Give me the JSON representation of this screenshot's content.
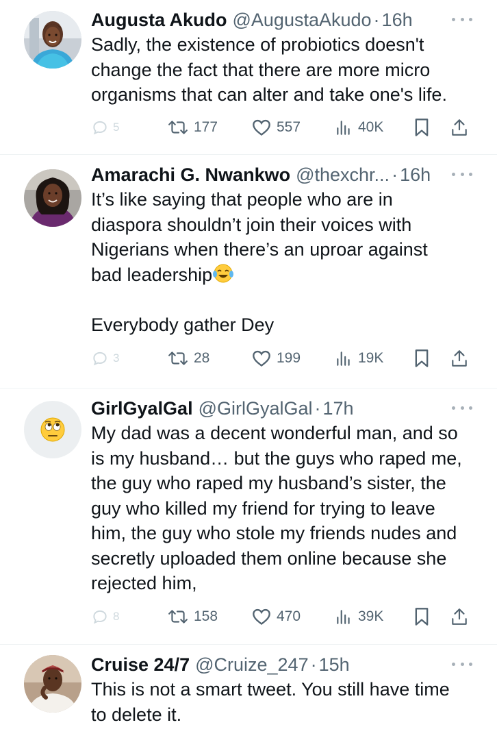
{
  "tweets": [
    {
      "display_name": "Augusta Akudo",
      "handle": "@AugustaAkudo",
      "separator": "·",
      "time": "16h",
      "text": "Sadly, the existence of probiotics doesn't\nchange the fact that there are more micro\norganisms that can alter and take one's life.",
      "replies": "5",
      "retweets": "177",
      "likes": "557",
      "views": "40K"
    },
    {
      "display_name": "Amarachi G. Nwankwo",
      "handle": "@thexchr...",
      "separator": "·",
      "time": "16h",
      "text_before_emoji": "It’s like saying that people who are in\ndiaspora shouldn’t join their voices with\nNigerians when there’s an uproar against\nbad leadership",
      "emoji": "face-with-tears-of-joy",
      "text_after_emoji": "\n\nEverybody gather Dey",
      "replies": "3",
      "retweets": "28",
      "likes": "199",
      "views": "19K"
    },
    {
      "display_name": "GirlGyalGal",
      "handle": "@GirlGyalGal",
      "separator": "·",
      "time": "17h",
      "text": "My dad was a decent wonderful man, and so\nis my husband… but the guys who raped me,\nthe guy who raped my husband’s sister, the\nguy who killed my friend for trying to leave\nhim, the guy who stole my friends nudes and\nsecretly uploaded them online because she\nrejected him,",
      "replies": "8",
      "retweets": "158",
      "likes": "470",
      "views": "39K"
    },
    {
      "display_name": "Cruise 24/7",
      "handle": "@Cruize_247",
      "separator": "·",
      "time": "15h",
      "text": "This is not a smart tweet. You still have time\nto delete it."
    }
  ],
  "icons": {
    "reply": "reply-icon",
    "retweet": "retweet-icon",
    "like": "heart-icon",
    "views": "views-icon",
    "bookmark": "bookmark-icon",
    "share": "share-icon",
    "more": "more-icon"
  },
  "colors": {
    "text": "#0f1419",
    "secondary": "#536471",
    "divider": "#eff3f4",
    "faded_reply": "#cfd9de"
  }
}
